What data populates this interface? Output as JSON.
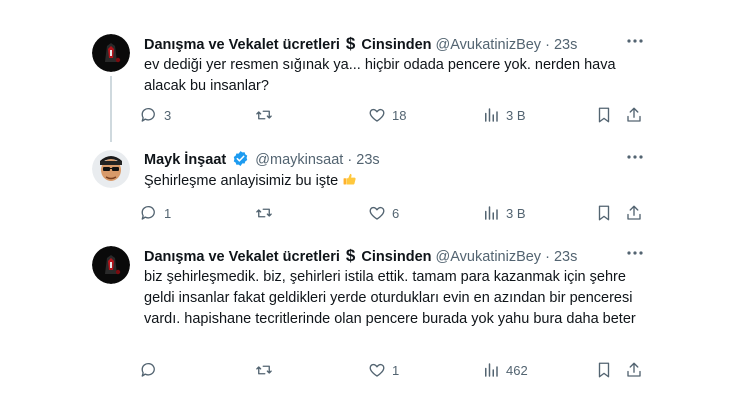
{
  "tweets": [
    {
      "name_part1": "Danışma ve Vekalet ücretleri",
      "name_symbol": "$",
      "name_part2": "Cinsinden",
      "handle": "@AvukatinizBey",
      "dot": "·",
      "time": "23s",
      "text": "ev dediği yer resmen sığınak ya... hiçbir odada pencere yok. nerden hava alacak bu insanlar?",
      "reply_count": "3",
      "retweet_count": "",
      "like_count": "18",
      "view_count": "3 B"
    },
    {
      "name": "Mayk İnşaat",
      "handle": "@maykinsaat",
      "dot": "·",
      "time": "23s",
      "text": "Şehirleşme anlayisimiz bu işte",
      "reply_count": "1",
      "retweet_count": "",
      "like_count": "6",
      "view_count": "3 B"
    },
    {
      "name_part1": "Danışma ve Vekalet ücretleri",
      "name_symbol": "$",
      "name_part2": "Cinsinden",
      "handle": "@AvukatinizBey",
      "dot": "·",
      "time": "23s",
      "text": "biz şehirleşmedik. biz, şehirleri istila ettik. tamam para kazanmak için şehre geldi insanlar fakat geldikleri yerde oturdukları evin en azından bir penceresi vardı. hapishane tecritlerinde olan pencere burada yok yahu bura daha beter",
      "reply_count": "",
      "retweet_count": "",
      "like_count": "1",
      "view_count": "462"
    }
  ],
  "icons": [
    "reply-icon",
    "retweet-icon",
    "like-icon",
    "views-icon",
    "bookmark-icon",
    "share-icon",
    "more-icon",
    "verified-badge-icon",
    "thumbs-up-emoji"
  ],
  "colors": {
    "text": "#0f1419",
    "secondary": "#536471",
    "verified": "#1d9bf0",
    "thread_line": "#cfd9de"
  }
}
